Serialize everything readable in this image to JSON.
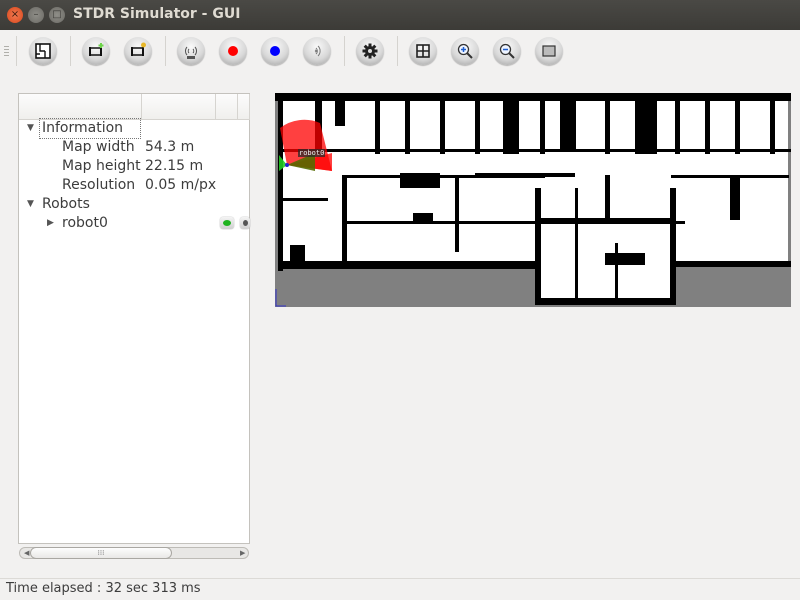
{
  "window": {
    "title": "STDR Simulator - GUI",
    "close_glyph": "×",
    "minimize_glyph": "–",
    "maximize_glyph": "□"
  },
  "toolbar": {
    "buttons": [
      {
        "name": "load-map-button",
        "icon": "map-icon"
      },
      {
        "name": "add-robot-button",
        "icon": "robot-add-icon"
      },
      {
        "name": "load-robot-button",
        "icon": "robot-load-icon"
      },
      {
        "name": "add-rfid-button",
        "icon": "rfid-icon"
      },
      {
        "name": "add-co2-source-button",
        "icon": "red-dot-icon",
        "color": "#ff0000"
      },
      {
        "name": "add-thermal-source-button",
        "icon": "blue-dot-icon",
        "color": "#0000ff"
      },
      {
        "name": "add-sound-source-button",
        "icon": "sound-icon"
      },
      {
        "name": "properties-button",
        "icon": "gear-icon"
      },
      {
        "name": "grid-button",
        "icon": "grid-icon"
      },
      {
        "name": "zoom-in-button",
        "icon": "zoom-in-icon"
      },
      {
        "name": "zoom-out-button",
        "icon": "zoom-out-icon"
      },
      {
        "name": "fit-view-button",
        "icon": "rectangle-icon"
      }
    ]
  },
  "tree": {
    "information": {
      "label": "Information",
      "rows": [
        {
          "key": "Map width",
          "value": "54.3 m"
        },
        {
          "key": "Map height",
          "value": "22.15 m"
        },
        {
          "key": "Resolution",
          "value": "0.05 m/px"
        }
      ]
    },
    "robots": {
      "label": "Robots",
      "items": [
        {
          "label": "robot0"
        }
      ]
    },
    "expanded_glyph": "▼",
    "collapsed_glyph": "▶"
  },
  "scrollbar": {
    "left_glyph": "◀",
    "right_glyph": "▶",
    "thumb_glyph": "⁞⁞⁞"
  },
  "map": {
    "robot_label": "robot0",
    "colors": {
      "unknown": "#808080",
      "free": "#ffffff",
      "occupied": "#000000",
      "laser": "#ff0000",
      "sonar": "#00cc00"
    }
  },
  "status": {
    "text": "Time elapsed : 32 sec 313 ms"
  }
}
